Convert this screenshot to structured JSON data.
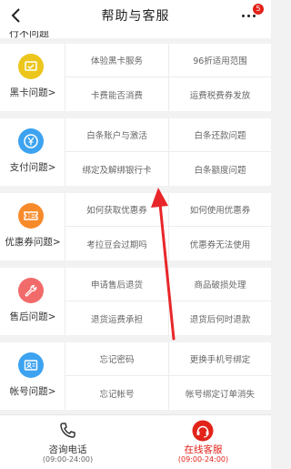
{
  "header": {
    "title": "帮助与客服",
    "badge": "5"
  },
  "partial_row": "行不问题",
  "sections": [
    {
      "category": "黑卡问题>",
      "icon": "black-card-icon",
      "color": "#ecc61c",
      "items": [
        "体验黑卡服务",
        "96折适用范围",
        "卡费能否消费",
        "运费税费券发放"
      ]
    },
    {
      "category": "支付问题>",
      "icon": "yuan-icon",
      "color": "#3da3f0",
      "items": [
        "白条账户与激活",
        "白条还款问题",
        "绑定及解绑银行卡",
        "白条额度问题"
      ]
    },
    {
      "category": "优惠券问题>",
      "icon": "coupon-icon",
      "color": "#f78b2b",
      "items": [
        "如何获取优惠券",
        "如何使用优惠券",
        "考拉豆会过期吗",
        "优惠券无法使用"
      ]
    },
    {
      "category": "售后问题>",
      "icon": "wrench-icon",
      "color": "#f26b6b",
      "items": [
        "申请售后退货",
        "商品破损处理",
        "退货运费承担",
        "退货后何时退款"
      ]
    },
    {
      "category": "帐号问题>",
      "icon": "account-icon",
      "color": "#3da3f0",
      "items": [
        "忘记密码",
        "更换手机号绑定",
        "忘记帐号",
        "帐号绑定订单消失"
      ]
    }
  ],
  "footer": {
    "phone": {
      "label": "咨询电话",
      "hours": "(09:00-24:00)"
    },
    "online": {
      "label": "在线客服",
      "hours": "(09:00-24:00)"
    }
  },
  "colors": {
    "accent": "#e2231a",
    "annotation_arrow": "#e8262a"
  }
}
